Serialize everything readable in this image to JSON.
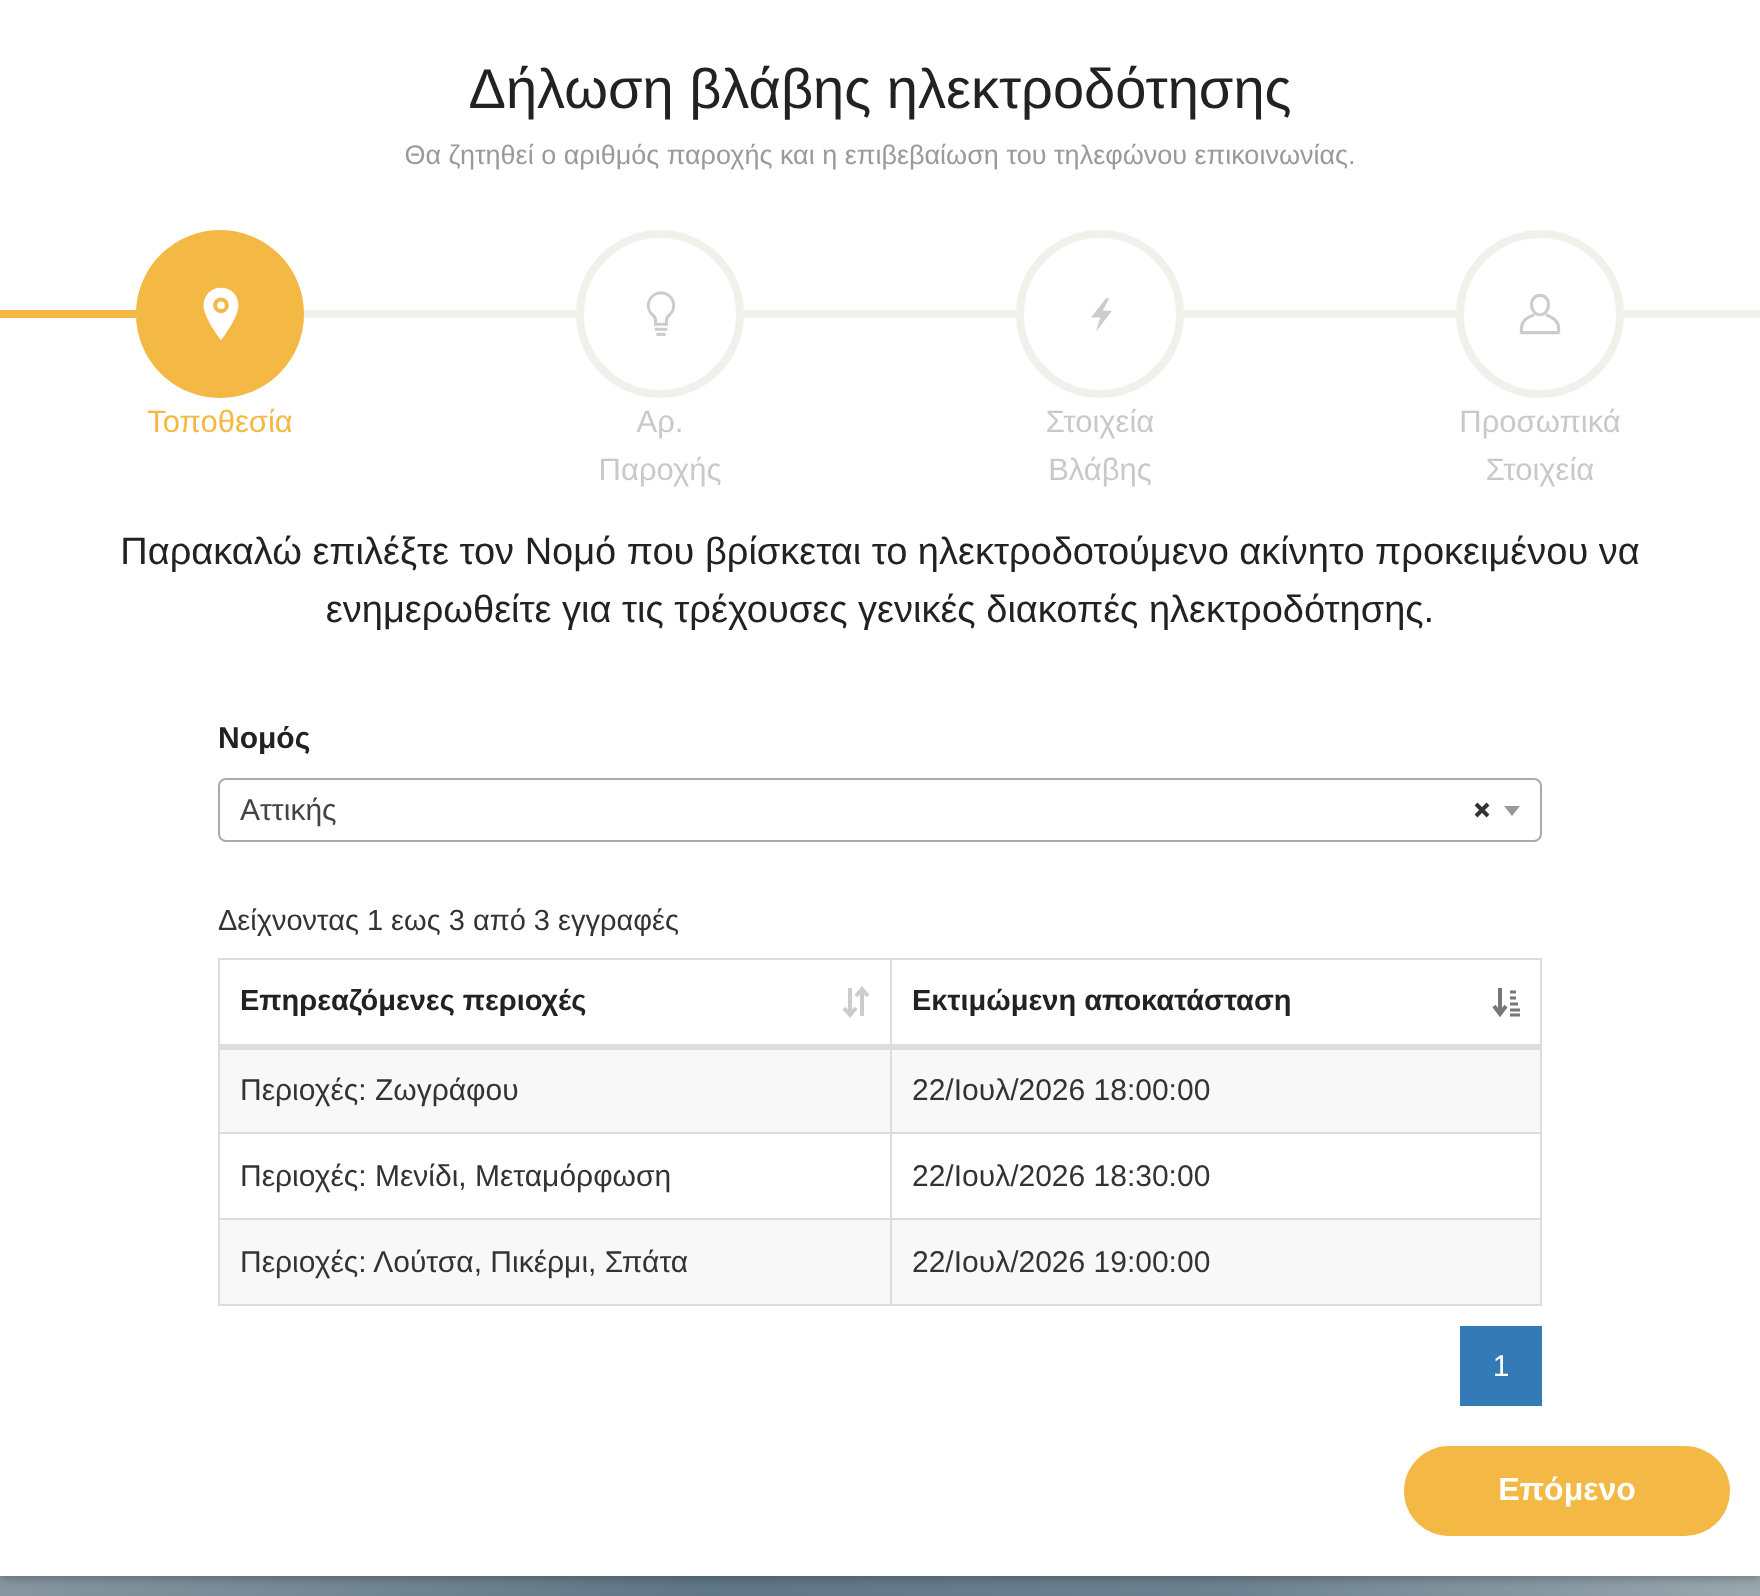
{
  "header": {
    "title": "Δήλωση βλάβης ηλεκτροδότησης",
    "subtitle": "Θα ζητηθεί ο αριθμός παροχής και η επιβεβαίωση του τηλεφώνου επικοινωνίας."
  },
  "steps": [
    {
      "label": "Τοποθεσία",
      "selected": true
    },
    {
      "label": "Αρ. Παροχής",
      "selected": false
    },
    {
      "label": "Στοιχεία Βλάβης",
      "selected": false
    },
    {
      "label": "Προσωπικά Στοιχεία",
      "selected": false
    }
  ],
  "instructions": "Παρακαλώ επιλέξτε τον Νομό που βρίσκεται το ηλεκτροδοτούμενο ακίνητο προκειμένου να ενημερωθείτε για τις τρέχουσες γενικές διακοπές ηλεκτροδότησης.",
  "county_field": {
    "label": "Νομός",
    "value": "Αττικής"
  },
  "table": {
    "info": "Δείχνοντας 1 εως 3 από 3 εγγραφές",
    "columns": [
      {
        "label": "Επηρεαζόμενες περιοχές",
        "sorted": false
      },
      {
        "label": "Εκτιμώμενη αποκατάσταση",
        "sorted": true
      }
    ],
    "rows": [
      [
        "Περιοχές: Ζωγράφου",
        "22/Ιουλ/2026 18:00:00"
      ],
      [
        "Περιοχές: Μενίδι, Μεταμόρφωση",
        "22/Ιουλ/2026 18:30:00"
      ],
      [
        "Περιοχές: Λούτσα, Πικέρμι, Σπάτα",
        "22/Ιουλ/2026 19:00:00"
      ]
    ]
  },
  "pagination": [
    {
      "label": "1",
      "selected": true
    }
  ],
  "next_button": "Επόμενο"
}
